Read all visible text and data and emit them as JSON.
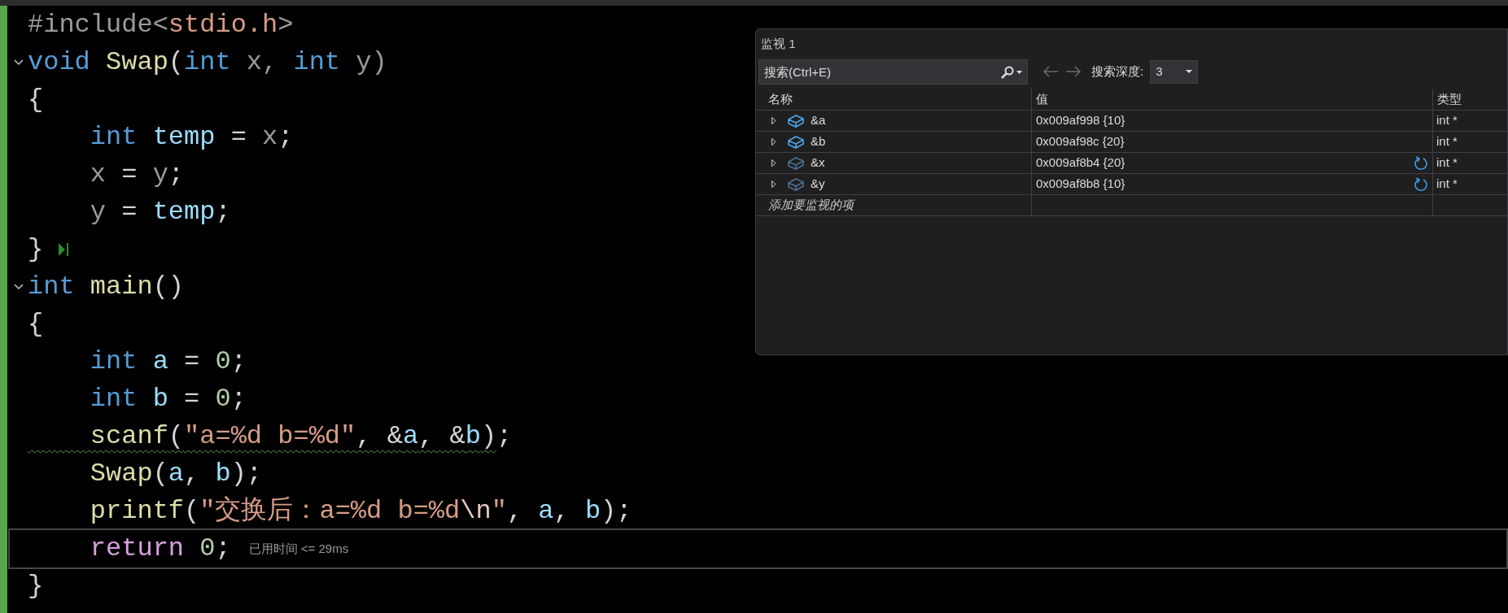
{
  "code": {
    "lines": [
      {
        "fold": false,
        "current": false,
        "warning": false,
        "tokens": [
          {
            "text": "#include<",
            "kind": "preproc"
          },
          {
            "text": "stdio.h",
            "kind": "string"
          },
          {
            "text": ">",
            "kind": "preproc"
          }
        ]
      },
      {
        "fold": true,
        "current": false,
        "warning": false,
        "tokens": [
          {
            "text": "void ",
            "kind": "keyword"
          },
          {
            "text": "Swap",
            "kind": "func"
          },
          {
            "text": "(",
            "kind": "plain"
          },
          {
            "text": "int",
            "kind": "keyword"
          },
          {
            "text": " x, ",
            "kind": "param"
          },
          {
            "text": "int",
            "kind": "keyword"
          },
          {
            "text": " y)",
            "kind": "param"
          }
        ]
      },
      {
        "fold": false,
        "current": false,
        "warning": false,
        "tokens": [
          {
            "text": "{",
            "kind": "plain"
          }
        ]
      },
      {
        "fold": false,
        "current": false,
        "warning": false,
        "tokens": [
          {
            "text": "    int ",
            "kind": "keyword"
          },
          {
            "text": "temp",
            "kind": "var"
          },
          {
            "text": " = ",
            "kind": "plain"
          },
          {
            "text": "x",
            "kind": "param"
          },
          {
            "text": ";",
            "kind": "plain"
          }
        ]
      },
      {
        "fold": false,
        "current": false,
        "warning": false,
        "tokens": [
          {
            "text": "    x",
            "kind": "param"
          },
          {
            "text": " = ",
            "kind": "plain"
          },
          {
            "text": "y",
            "kind": "param"
          },
          {
            "text": ";",
            "kind": "plain"
          }
        ]
      },
      {
        "fold": false,
        "current": false,
        "warning": false,
        "tokens": [
          {
            "text": "    y",
            "kind": "param"
          },
          {
            "text": " = ",
            "kind": "plain"
          },
          {
            "text": "temp",
            "kind": "var"
          },
          {
            "text": ";",
            "kind": "plain"
          }
        ]
      },
      {
        "fold": false,
        "current": false,
        "warning": false,
        "tokens": [
          {
            "text": "}",
            "kind": "plain"
          },
          {
            "kind": "marker"
          }
        ]
      },
      {
        "fold": true,
        "current": false,
        "warning": false,
        "tokens": [
          {
            "text": "int ",
            "kind": "keyword"
          },
          {
            "text": "main",
            "kind": "func"
          },
          {
            "text": "()",
            "kind": "plain"
          }
        ]
      },
      {
        "fold": false,
        "current": false,
        "warning": false,
        "tokens": [
          {
            "text": "{",
            "kind": "plain"
          }
        ]
      },
      {
        "fold": false,
        "current": false,
        "warning": false,
        "tokens": [
          {
            "text": "    int ",
            "kind": "keyword"
          },
          {
            "text": "a",
            "kind": "var"
          },
          {
            "text": " = ",
            "kind": "plain"
          },
          {
            "text": "0",
            "kind": "number"
          },
          {
            "text": ";",
            "kind": "plain"
          }
        ]
      },
      {
        "fold": false,
        "current": false,
        "warning": false,
        "tokens": [
          {
            "text": "    int ",
            "kind": "keyword"
          },
          {
            "text": "b",
            "kind": "var"
          },
          {
            "text": " = ",
            "kind": "plain"
          },
          {
            "text": "0",
            "kind": "number"
          },
          {
            "text": ";",
            "kind": "plain"
          }
        ]
      },
      {
        "fold": false,
        "current": false,
        "warning": true,
        "tokens": [
          {
            "text": "    scanf",
            "kind": "func"
          },
          {
            "text": "(",
            "kind": "plain"
          },
          {
            "text": "\"a=%d b=%d\"",
            "kind": "string"
          },
          {
            "text": ", &",
            "kind": "plain"
          },
          {
            "text": "a",
            "kind": "var"
          },
          {
            "text": ", &",
            "kind": "plain"
          },
          {
            "text": "b",
            "kind": "var"
          },
          {
            "text": ")",
            "kind": "plain"
          },
          {
            "text": ";",
            "kind": "plain"
          }
        ]
      },
      {
        "fold": false,
        "current": false,
        "warning": false,
        "tokens": [
          {
            "text": "    Swap",
            "kind": "func"
          },
          {
            "text": "(",
            "kind": "plain"
          },
          {
            "text": "a",
            "kind": "var"
          },
          {
            "text": ", ",
            "kind": "plain"
          },
          {
            "text": "b",
            "kind": "var"
          },
          {
            "text": ");",
            "kind": "plain"
          }
        ]
      },
      {
        "fold": false,
        "current": false,
        "warning": false,
        "tokens": [
          {
            "text": "    printf",
            "kind": "func"
          },
          {
            "text": "(",
            "kind": "plain"
          },
          {
            "text": "\"交换后：a=%d b=%d",
            "kind": "string"
          },
          {
            "text": "\\n",
            "kind": "escape"
          },
          {
            "text": "\"",
            "kind": "string"
          },
          {
            "text": ", ",
            "kind": "plain"
          },
          {
            "text": "a",
            "kind": "var"
          },
          {
            "text": ", ",
            "kind": "plain"
          },
          {
            "text": "b",
            "kind": "var"
          },
          {
            "text": ");",
            "kind": "plain"
          }
        ]
      },
      {
        "fold": false,
        "current": true,
        "warning": false,
        "tokens": [
          {
            "text": "    return ",
            "kind": "control"
          },
          {
            "text": "0",
            "kind": "number"
          },
          {
            "text": ";",
            "kind": "plain"
          },
          {
            "text": "已用时间 <= 29ms",
            "kind": "annotation"
          }
        ]
      },
      {
        "fold": false,
        "current": false,
        "warning": false,
        "tokens": [
          {
            "text": "}",
            "kind": "plain"
          }
        ]
      }
    ]
  },
  "watch": {
    "title": "监视 1",
    "search": {
      "placeholder": "搜索(Ctrl+E)"
    },
    "depth_label": "搜索深度:",
    "depth_value": "3",
    "columns": [
      "名称",
      "值",
      "类型"
    ],
    "rows": [
      {
        "name": "&a",
        "value": "0x009af998 {10}",
        "type": "int *",
        "stale": false
      },
      {
        "name": "&b",
        "value": "0x009af98c {20}",
        "type": "int *",
        "stale": false
      },
      {
        "name": "&x",
        "value": "0x009af8b4 {20}",
        "type": "int *",
        "stale": true
      },
      {
        "name": "&y",
        "value": "0x009af8b8 {10}",
        "type": "int *",
        "stale": true
      }
    ],
    "add_placeholder": "添加要监视的项"
  }
}
